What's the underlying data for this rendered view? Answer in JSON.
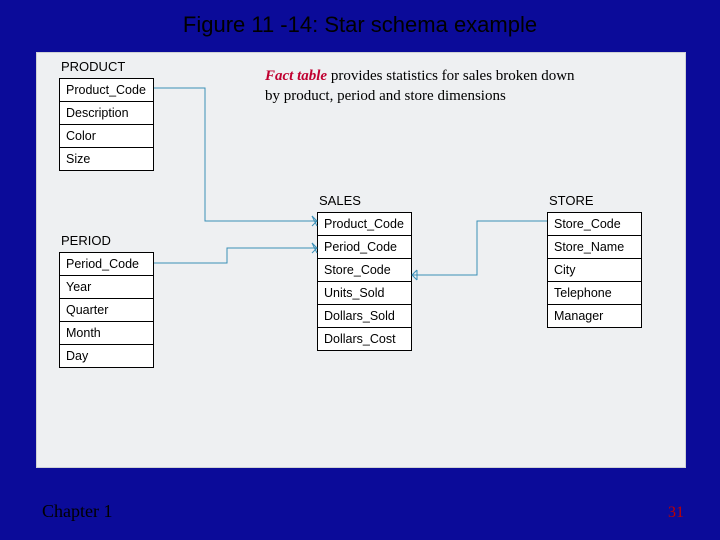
{
  "title": "Figure 11 -14: Star schema example",
  "annotation": {
    "emph": "Fact table",
    "rest": " provides statistics for sales broken down by product, period and store dimensions"
  },
  "footer": {
    "left": "Chapter 1",
    "right": "31"
  },
  "entities": {
    "product": {
      "name": "PRODUCT",
      "cols": [
        "Product_Code",
        "Description",
        "Color",
        "Size"
      ]
    },
    "period": {
      "name": "PERIOD",
      "cols": [
        "Period_Code",
        "Year",
        "Quarter",
        "Month",
        "Day"
      ]
    },
    "sales": {
      "name": "SALES",
      "cols": [
        "Product_Code",
        "Period_Code",
        "Store_Code",
        "Units_Sold",
        "Dollars_Sold",
        "Dollars_Cost"
      ]
    },
    "store": {
      "name": "STORE",
      "cols": [
        "Store_Code",
        "Store_Name",
        "City",
        "Telephone",
        "Manager"
      ]
    }
  }
}
